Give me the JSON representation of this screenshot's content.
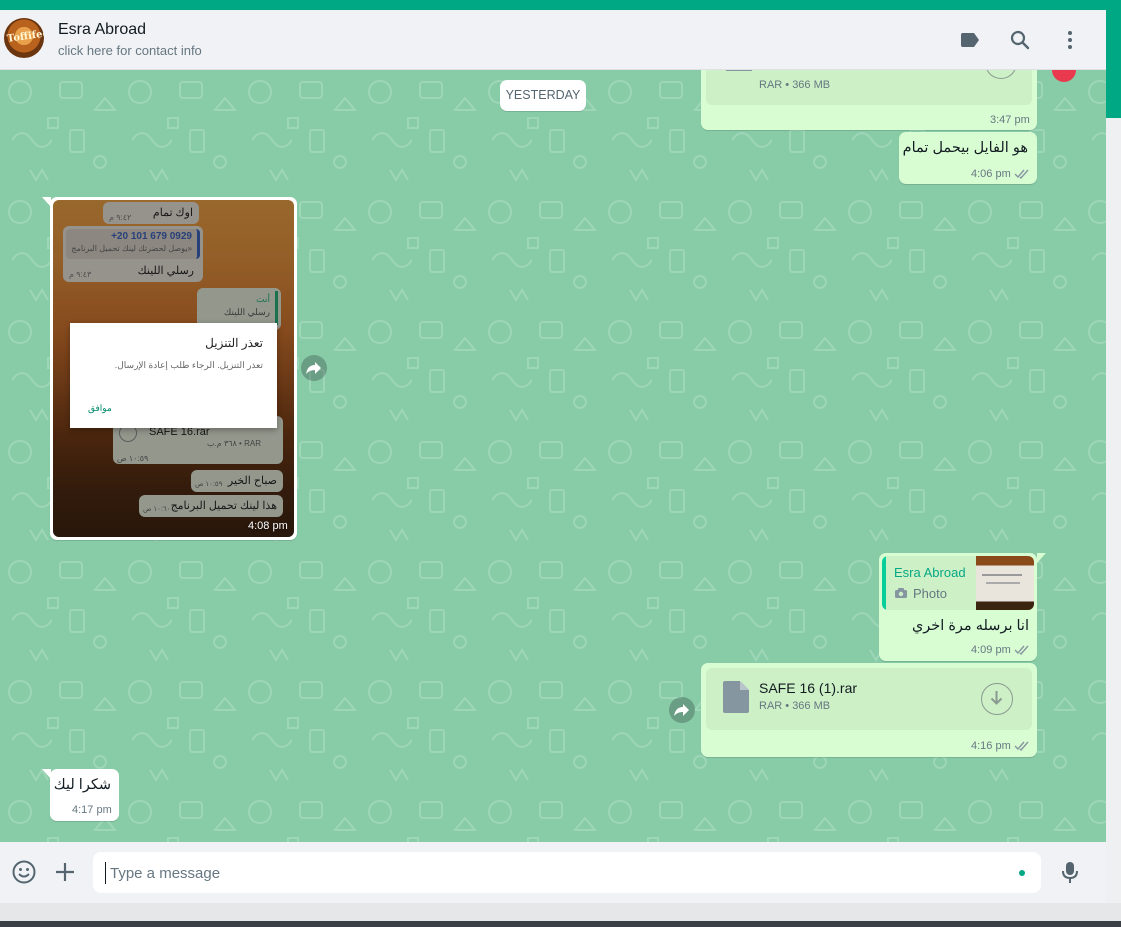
{
  "header": {
    "avatar_text": "Toffifee",
    "contact_name": "Esra Abroad",
    "contact_subtitle": "click here for contact info",
    "icons": [
      "label-icon",
      "search-icon",
      "menu-icon"
    ]
  },
  "chat": {
    "date_chip": "YESTERDAY",
    "file_top": {
      "meta": "RAR • 366 MB",
      "time": "3:47 pm"
    },
    "msg_out_1": {
      "text": "هو الفايل بيحمل تمام",
      "time": "4:06 pm"
    },
    "image_msg": {
      "time": "4:08 pm",
      "inner": {
        "msg1_text": "اوك تمام",
        "msg1_time": "٩:٤٢ م",
        "phone": "+20 101 679 0929",
        "quoted": "«يوصل لحضرتك لينك تحميل البرنامج",
        "reply_text": "رسلي اللينك",
        "reply_time": "٩:٤٣ م",
        "you_label": "أنت",
        "you_quote": "رسلي اللينك",
        "file_name": "SAFE 16.rar",
        "file_meta": "RAR • ٣٦٨ م.ب",
        "file_time": "١٠:٥٩ ص",
        "morning": "صباح الخير",
        "morning_time": "١٠:٥٩ ص",
        "link_msg": "هذا لينك تحميل البرنامج",
        "link_time": "١٠:٦٠ ص",
        "dialog_title": "تعذر التنزيل",
        "dialog_body": "تعذر التنزيل. الرجاء طلب إعادة الإرسال.",
        "dialog_ok": "موافق"
      }
    },
    "reply_msg": {
      "quoted_author": "Esra Abroad",
      "quoted_type": "Photo",
      "text": "انا برسله مرة اخري",
      "time": "4:09 pm"
    },
    "file_bottom": {
      "name": "SAFE 16 (1).rar",
      "meta": "RAR • 366 MB",
      "time": "4:16 pm"
    },
    "msg_in_last": {
      "text": "شكرا ليك",
      "time": "4:17 pm"
    }
  },
  "composer": {
    "placeholder": "Type a message"
  },
  "colors": {
    "accent": "#00a884",
    "chat_bg": "#88cba7",
    "bubble_out": "#d9fdd3",
    "bubble_in": "#ffffff",
    "ticks": "#8696a0"
  }
}
